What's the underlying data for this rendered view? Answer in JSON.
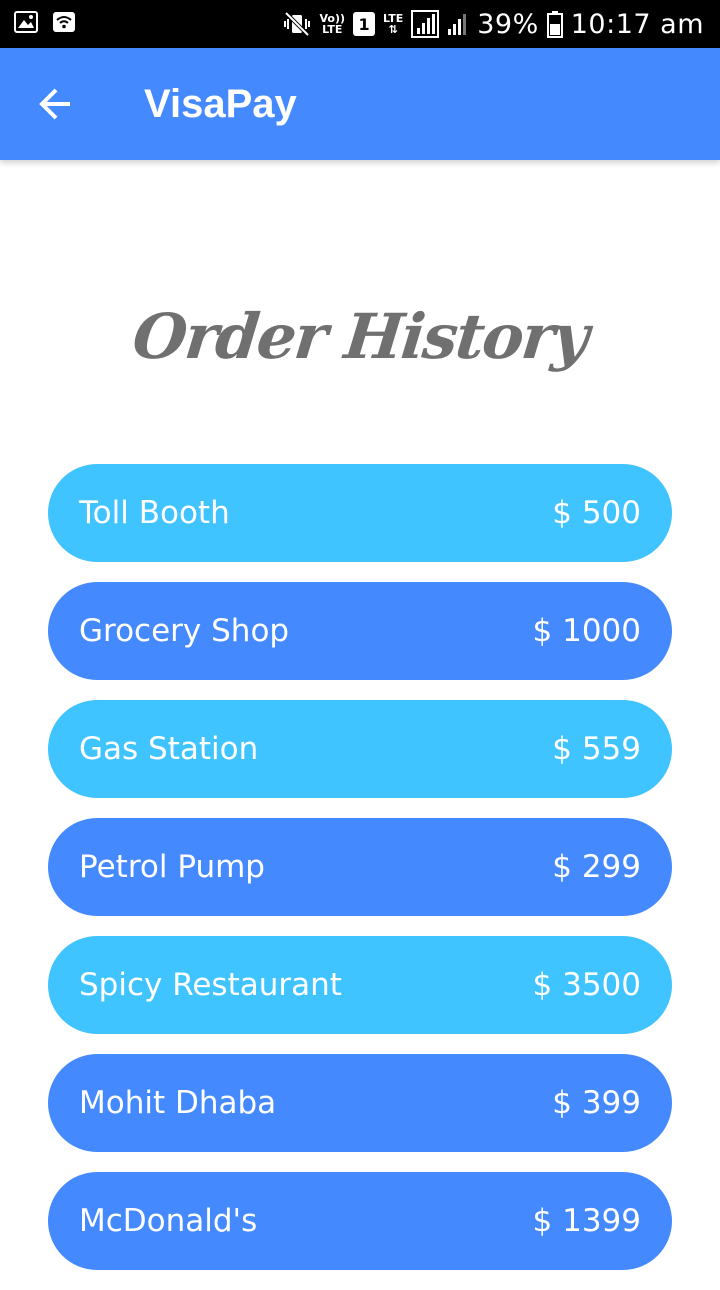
{
  "status_bar": {
    "volte_top": "Vo))",
    "volte_bottom": "LTE",
    "sim_slot": "1",
    "lte_top": "LTE",
    "battery": "39%",
    "time": "10:17 am"
  },
  "app_bar": {
    "title": "VisaPay"
  },
  "page": {
    "heading": "Order History"
  },
  "orders": [
    {
      "name": "Toll Booth",
      "amount": "$ 500",
      "color": "#40c4ff"
    },
    {
      "name": "Grocery Shop",
      "amount": "$ 1000",
      "color": "#4589ff"
    },
    {
      "name": "Gas Station",
      "amount": "$ 559",
      "color": "#40c4ff"
    },
    {
      "name": "Petrol Pump",
      "amount": "$ 299",
      "color": "#4589ff"
    },
    {
      "name": "Spicy Restaurant",
      "amount": "$ 3500",
      "color": "#40c4ff"
    },
    {
      "name": "Mohit Dhaba",
      "amount": "$ 399",
      "color": "#4589ff"
    },
    {
      "name": "McDonald's",
      "amount": "$ 1399",
      "color": "#4589ff"
    }
  ],
  "colors": {
    "primary": "#4589ff",
    "accent": "#40c4ff",
    "heading": "#707070"
  }
}
